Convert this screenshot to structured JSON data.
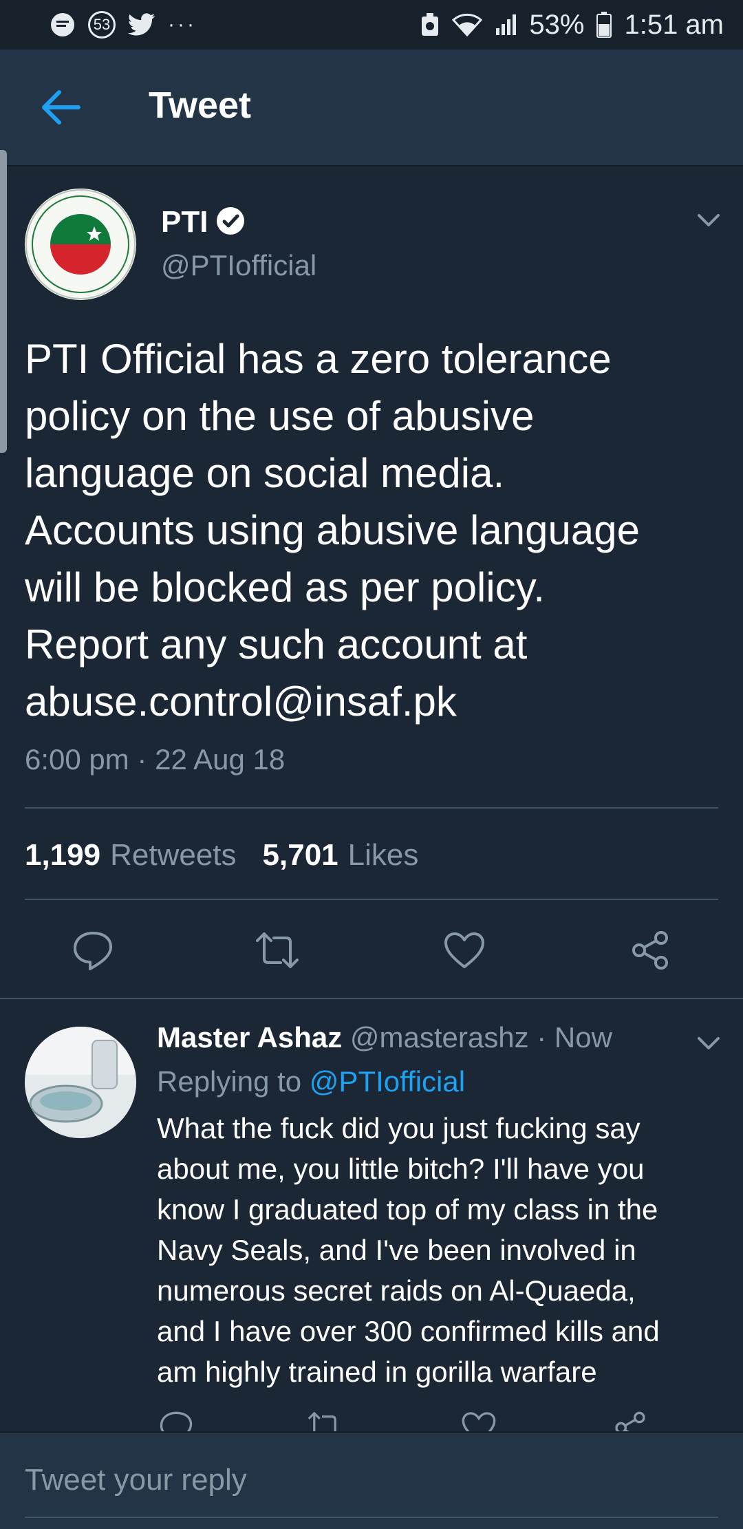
{
  "status_bar": {
    "notification_count": "53",
    "battery": "53%",
    "time": "1:51 am"
  },
  "header": {
    "title": "Tweet"
  },
  "tweet": {
    "author_name": "PTI",
    "handle": "@PTIofficial",
    "text": "PTI Official has a zero tolerance\npolicy on the use of abusive\nlanguage on social media.\nAccounts using abusive language\nwill be blocked as per policy.\nReport any such account at\nabuse.control@insaf.pk",
    "timestamp": "6:00 pm · 22 Aug 18",
    "retweets_count": "1,199",
    "retweets_label": "Retweets",
    "likes_count": "5,701",
    "likes_label": "Likes"
  },
  "reply": {
    "author_name": "Master Ashaz",
    "handle_time": "@masterashz · Now",
    "replying_prefix": "Replying to",
    "replying_to": "@PTIofficial",
    "text": "What the fuck did you just fucking say\nabout me, you little bitch? I'll have you\nknow I graduated top of my class in the\nNavy Seals, and I've been involved in\nnumerous secret raids on Al-Quaeda,\nand I have over 300 confirmed kills and\nam highly trained in gorilla warfare"
  },
  "composer": {
    "placeholder": "Tweet your reply"
  },
  "colors": {
    "background": "#1b2735",
    "header": "#243447",
    "accent": "#1da1f2",
    "muted_text": "#8899a6"
  },
  "icons": {
    "back": "arrow-left-icon",
    "verified": "verified-badge-icon",
    "reply": "reply-icon",
    "retweet": "retweet-icon",
    "like": "heart-icon",
    "share": "share-icon"
  }
}
